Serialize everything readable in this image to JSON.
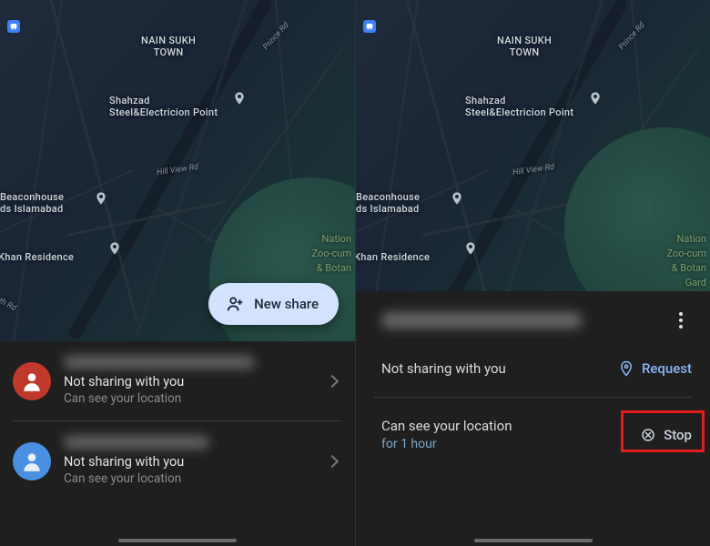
{
  "map": {
    "labels": {
      "nain_sukh": "NAIN SUKH\nTOWN",
      "shahzad": "Shahzad\nSteel&Electricion Point",
      "beaconhouse": "Beaconhouse\nds Islamabad",
      "khan": "Khan Residence",
      "nation": "Nation",
      "zoo": "Zoo-cum",
      "botan": "& Botan",
      "gard": "Gard",
      "hill_view": "Hill View Rd",
      "prince": "Prince Rd",
      "th_rd": "th Rd"
    }
  },
  "new_share_label": "New share",
  "left_sheet": {
    "contacts": [
      {
        "line1": "Not sharing with you",
        "line2": "Can see your location"
      },
      {
        "line1": "Not sharing with you",
        "line2": "Can see your location"
      }
    ]
  },
  "right_sheet": {
    "row1_text": "Not sharing with you",
    "row1_action": "Request",
    "row2_text": "Can see your location",
    "row2_sub": "for 1 hour",
    "row2_action": "Stop"
  }
}
